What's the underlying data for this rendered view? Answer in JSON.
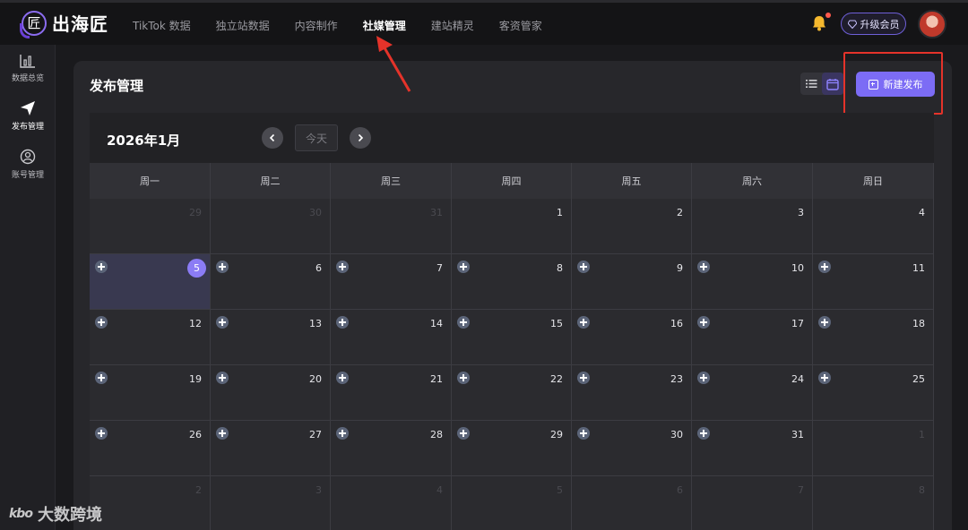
{
  "header": {
    "logo_text": "出海匠",
    "logo_mark": "匠",
    "nav": [
      "TikTok 数据",
      "独立站数据",
      "内容制作",
      "社媒管理",
      "建站精灵",
      "客资管家"
    ],
    "active_nav_index": 3,
    "upgrade_label": "升级会员",
    "icons": [
      "bell-icon",
      "diamond-icon",
      "avatar"
    ]
  },
  "sidebar": {
    "items": [
      {
        "label": "数据总览",
        "icon": "bar-chart-icon"
      },
      {
        "label": "发布管理",
        "icon": "send-icon"
      },
      {
        "label": "账号管理",
        "icon": "user-circle-icon"
      }
    ]
  },
  "page": {
    "title": "发布管理",
    "new_button_label": "新建发布",
    "view_modes": [
      "list-view-icon",
      "calendar-view-icon"
    ],
    "active_view": "calendar"
  },
  "calendar": {
    "month_label": "2026年1月",
    "today_label": "今天",
    "weekdays": [
      "周一",
      "周二",
      "周三",
      "周四",
      "周五",
      "周六",
      "周日"
    ],
    "weeks": [
      [
        {
          "d": "29",
          "cur": false
        },
        {
          "d": "30",
          "cur": false
        },
        {
          "d": "31",
          "cur": false
        },
        {
          "d": "1",
          "cur": true
        },
        {
          "d": "2",
          "cur": true
        },
        {
          "d": "3",
          "cur": true
        },
        {
          "d": "4",
          "cur": true
        }
      ],
      [
        {
          "d": "5",
          "cur": true,
          "today": true,
          "add": true
        },
        {
          "d": "6",
          "cur": true,
          "add": true
        },
        {
          "d": "7",
          "cur": true,
          "add": true
        },
        {
          "d": "8",
          "cur": true,
          "add": true
        },
        {
          "d": "9",
          "cur": true,
          "add": true
        },
        {
          "d": "10",
          "cur": true,
          "add": true
        },
        {
          "d": "11",
          "cur": true,
          "add": true
        }
      ],
      [
        {
          "d": "12",
          "cur": true,
          "add": true
        },
        {
          "d": "13",
          "cur": true,
          "add": true
        },
        {
          "d": "14",
          "cur": true,
          "add": true
        },
        {
          "d": "15",
          "cur": true,
          "add": true
        },
        {
          "d": "16",
          "cur": true,
          "add": true
        },
        {
          "d": "17",
          "cur": true,
          "add": true
        },
        {
          "d": "18",
          "cur": true,
          "add": true
        }
      ],
      [
        {
          "d": "19",
          "cur": true,
          "add": true
        },
        {
          "d": "20",
          "cur": true,
          "add": true
        },
        {
          "d": "21",
          "cur": true,
          "add": true
        },
        {
          "d": "22",
          "cur": true,
          "add": true
        },
        {
          "d": "23",
          "cur": true,
          "add": true
        },
        {
          "d": "24",
          "cur": true,
          "add": true
        },
        {
          "d": "25",
          "cur": true,
          "add": true
        }
      ],
      [
        {
          "d": "26",
          "cur": true,
          "add": true
        },
        {
          "d": "27",
          "cur": true,
          "add": true
        },
        {
          "d": "28",
          "cur": true,
          "add": true
        },
        {
          "d": "29",
          "cur": true,
          "add": true
        },
        {
          "d": "30",
          "cur": true,
          "add": true
        },
        {
          "d": "31",
          "cur": true,
          "add": true
        },
        {
          "d": "1",
          "cur": false
        }
      ],
      [
        {
          "d": "2",
          "cur": false
        },
        {
          "d": "3",
          "cur": false
        },
        {
          "d": "4",
          "cur": false
        },
        {
          "d": "5",
          "cur": false
        },
        {
          "d": "6",
          "cur": false
        },
        {
          "d": "7",
          "cur": false
        },
        {
          "d": "8",
          "cur": false
        }
      ]
    ]
  },
  "watermark": {
    "logo": "kbo",
    "text": "大数跨境"
  },
  "colors": {
    "accent": "#7c6cf5",
    "highlight_box": "#e5332a",
    "today_badge": "#8b7cf5"
  }
}
